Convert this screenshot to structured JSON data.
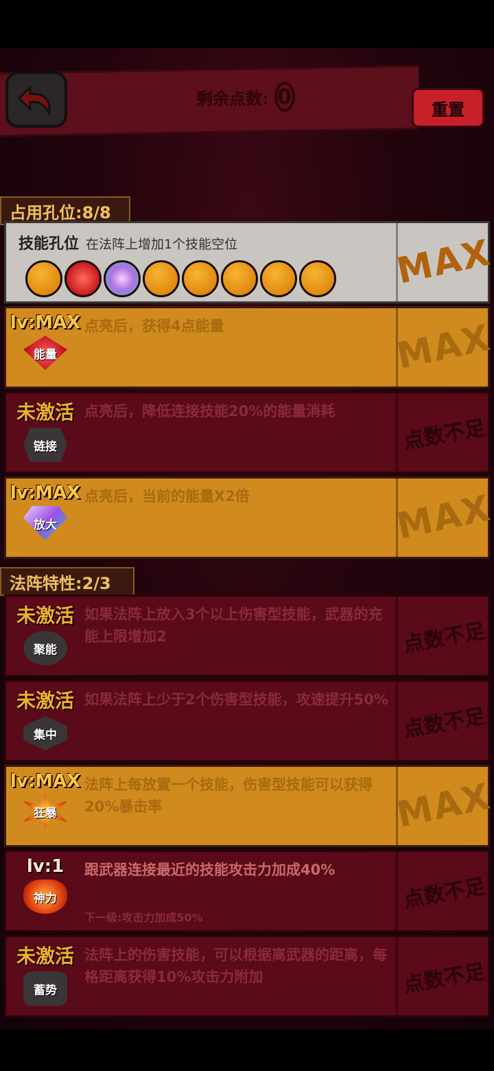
{
  "header": {
    "remaining_points_label": "剩余点数:",
    "remaining_points_value": "0",
    "reset_label": "重置"
  },
  "sections": {
    "slots_tag": "占用孔位:8/8",
    "array_traits_tag": "法阵特性:2/3"
  },
  "slot_row": {
    "title": "技能孔位",
    "description": "在法阵上增加1个技能空位",
    "side_label": "MAX",
    "slots": [
      "orange",
      "red-gem",
      "purple-gem",
      "orange",
      "orange",
      "orange",
      "orange",
      "orange"
    ]
  },
  "skills": [
    {
      "status": "lv:MAX",
      "icon_label": "能量",
      "icon": "red-gem-icon",
      "description": "点亮后，获得4点能量",
      "side": "MAX",
      "style": "orange"
    },
    {
      "status": "未激活",
      "icon_label": "链接",
      "icon": "link-icon",
      "description": "点亮后，降低连接技能20%的能量消耗",
      "side": "点数不足",
      "style": "red"
    },
    {
      "status": "lv:MAX",
      "icon_label": "放大",
      "icon": "purple-gem-icon",
      "description": "点亮后，当前的能量X2倍",
      "side": "MAX",
      "style": "orange"
    },
    {
      "status": "未激活",
      "icon_label": "聚能",
      "icon": "focus-icon",
      "description": "如果法阵上放入3个以上伤害型技能，武器的充能上限增加2",
      "side": "点数不足",
      "style": "red"
    },
    {
      "status": "未激活",
      "icon_label": "集中",
      "icon": "concentrate-icon",
      "description": "如果法阵上少于2个伤害型技能，攻速提升50%",
      "side": "点数不足",
      "style": "red"
    },
    {
      "status": "lv:MAX",
      "icon_label": "狂暴",
      "icon": "rage-icon",
      "description": "法阵上每放置一个技能，伤害型技能可以获得20%暴击率",
      "side": "MAX",
      "style": "orange"
    },
    {
      "status": "lv:1",
      "icon_label": "神力",
      "icon": "divine-power-icon",
      "description": "跟武器连接最近的技能攻击力加成40%",
      "next_level": "下一级:攻击力加成50%",
      "side": "点数不足",
      "style": "red"
    },
    {
      "status": "未激活",
      "icon_label": "蓄势",
      "icon": "charge-icon",
      "description": "法阵上的伤害技能，可以根据离武器的距离，每格距离获得10%攻击力附加",
      "side": "点数不足",
      "style": "red"
    }
  ]
}
